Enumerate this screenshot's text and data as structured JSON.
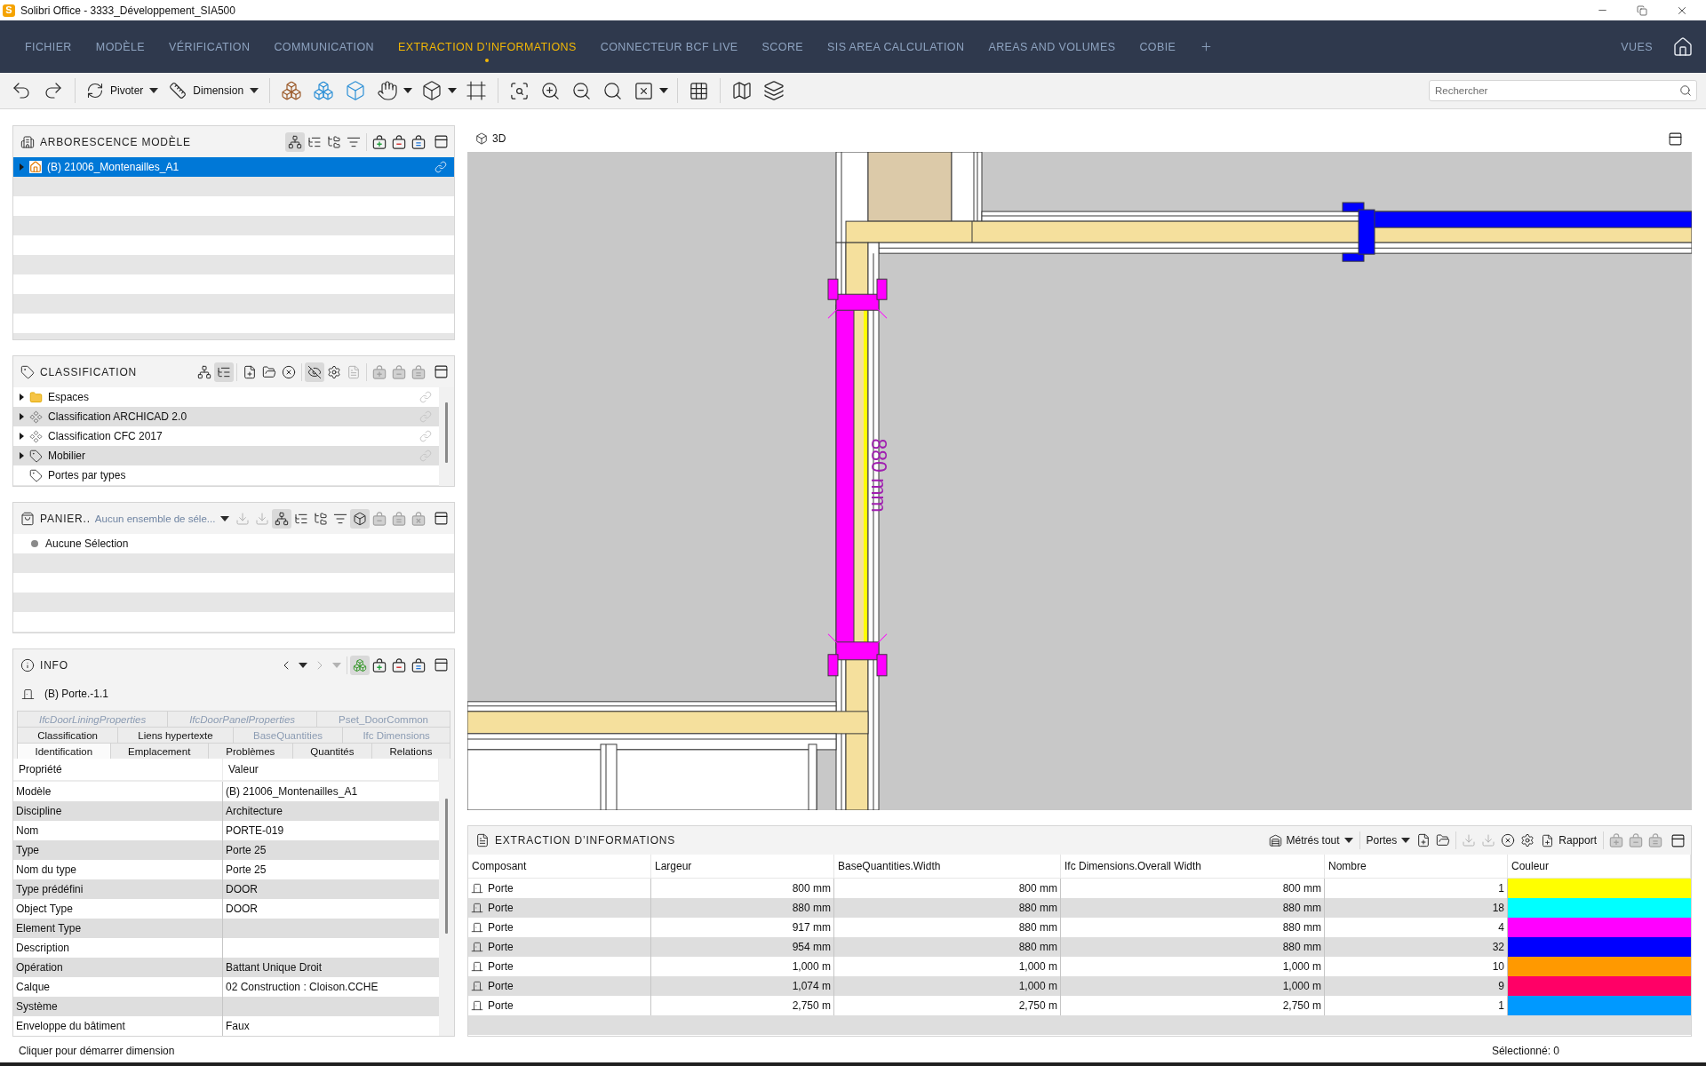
{
  "window": {
    "logo": "S",
    "title": "Solibri Office - 3333_Développement_SIA500"
  },
  "menu": {
    "items": [
      {
        "label": "FICHIER",
        "selected": false
      },
      {
        "label": "MODÈLE",
        "selected": false
      },
      {
        "label": "VÉRIFICATION",
        "selected": false
      },
      {
        "label": "COMMUNICATION",
        "selected": false
      },
      {
        "label": "EXTRACTION D’INFORMATIONS",
        "selected": true
      },
      {
        "label": "CONNECTEUR BCF LIVE",
        "selected": false
      },
      {
        "label": "SCORE",
        "selected": false
      },
      {
        "label": "SIS AREA CALCULATION",
        "selected": false
      },
      {
        "label": "AREAS AND VOLUMES",
        "selected": false
      },
      {
        "label": "COBIE",
        "selected": false
      }
    ],
    "views": "VUES"
  },
  "toolbar": {
    "rotate": "Pivoter",
    "dimension": "Dimension",
    "search": {
      "placeholder": "Rechercher"
    }
  },
  "model_tree": {
    "title": "ARBORESCENCE MODÈLE",
    "tools": [
      {
        "pressed": true,
        "disabled": false
      },
      {
        "pressed": false,
        "disabled": false
      },
      {
        "pressed": false,
        "disabled": false
      },
      {
        "pressed": false,
        "disabled": false
      },
      {
        "pressed": false,
        "disabled": false
      },
      {
        "pressed": false,
        "disabled": false
      },
      {
        "pressed": false,
        "disabled": false
      }
    ],
    "items": [
      {
        "label": "(B) 21006_Montenailles_A1",
        "selected": true,
        "expanded": false,
        "linked": true
      }
    ]
  },
  "classification": {
    "title": "CLASSIFICATION",
    "tools": [
      {
        "pressed": false,
        "disabled": false
      },
      {
        "pressed": true,
        "disabled": false
      },
      {
        "pressed": false,
        "disabled": false
      },
      {
        "pressed": false,
        "disabled": false
      },
      {
        "pressed": false,
        "disabled": false
      },
      {
        "pressed": true,
        "disabled": false
      },
      {
        "pressed": false,
        "disabled": false
      },
      {
        "pressed": false,
        "disabled": true
      },
      {
        "pressed": false,
        "disabled": true
      },
      {
        "pressed": false,
        "disabled": true
      },
      {
        "pressed": false,
        "disabled": true
      }
    ],
    "items": [
      {
        "label": "Espaces",
        "kind": "folder",
        "selected": false,
        "expanded": false,
        "linked": true
      },
      {
        "label": "Classification ARCHICAD 2.0",
        "kind": "classification",
        "selected": false,
        "expanded": false,
        "linked": true
      },
      {
        "label": "Classification CFC 2017",
        "kind": "classification",
        "selected": false,
        "expanded": false,
        "linked": true
      },
      {
        "label": "Mobilier",
        "kind": "tag",
        "selected": false,
        "expanded": false,
        "linked": true
      },
      {
        "label": "Portes par types",
        "kind": "tag",
        "selected": false,
        "linked": false
      }
    ]
  },
  "basket": {
    "title": "PANIER..",
    "selection_set": "Aucun ensemble de séle...",
    "tools": [
      {
        "pressed": false,
        "disabled": true
      },
      {
        "pressed": false,
        "disabled": true
      },
      {
        "pressed": true,
        "disabled": false
      },
      {
        "pressed": false,
        "disabled": false
      },
      {
        "pressed": false,
        "disabled": false
      },
      {
        "pressed": false,
        "disabled": false
      },
      {
        "pressed": true,
        "disabled": false
      },
      {
        "pressed": false,
        "disabled": true
      },
      {
        "pressed": false,
        "disabled": true
      },
      {
        "pressed": false,
        "disabled": true
      }
    ],
    "message": "Aucune Sélection"
  },
  "info": {
    "title": "INFO",
    "tools": [
      {
        "pressed": false,
        "disabled": false
      },
      {
        "pressed": false,
        "disabled": false
      },
      {
        "pressed": false,
        "disabled": true
      },
      {
        "pressed": false,
        "disabled": true
      },
      {
        "pressed": true,
        "disabled": false
      },
      {
        "pressed": false,
        "disabled": false
      },
      {
        "pressed": false,
        "disabled": false
      },
      {
        "pressed": false,
        "disabled": false
      }
    ],
    "object": "(B) Porte.-1.1",
    "tab_rows": [
      [
        {
          "label": "IfcDoorLiningProperties",
          "kind": "type_property_set",
          "selected": false
        },
        {
          "label": "IfcDoorPanelProperties",
          "kind": "type_property_set",
          "selected": false
        },
        {
          "label": "Pset_DoorCommon",
          "kind": "property_set",
          "selected": false
        }
      ],
      [
        {
          "label": "Classification",
          "kind": "standard",
          "selected": false
        },
        {
          "label": "Liens hypertexte",
          "kind": "standard",
          "selected": false
        },
        {
          "label": "BaseQuantities",
          "kind": "property_set",
          "selected": false
        },
        {
          "label": "Ifc Dimensions",
          "kind": "property_set",
          "selected": false
        }
      ],
      [
        {
          "label": "Identification",
          "kind": "standard",
          "selected": true
        },
        {
          "label": "Emplacement",
          "kind": "standard",
          "selected": false
        },
        {
          "label": "Problèmes",
          "kind": "standard",
          "selected": false
        },
        {
          "label": "Quantités",
          "kind": "standard",
          "selected": false
        },
        {
          "label": "Relations",
          "kind": "standard",
          "selected": false
        }
      ]
    ],
    "table": {
      "columns": [
        "Propriété",
        "Valeur"
      ],
      "rows": [
        {
          "property": "Modèle",
          "value": "(B) 21006_Montenailles_A1"
        },
        {
          "property": "Discipline",
          "value": "Architecture"
        },
        {
          "property": "Nom",
          "value": "PORTE-019"
        },
        {
          "property": "Type",
          "value": "Porte 25"
        },
        {
          "property": "Nom du type",
          "value": "Porte 25"
        },
        {
          "property": "Type prédéfini",
          "value": "DOOR"
        },
        {
          "property": "Object Type",
          "value": "DOOR"
        },
        {
          "property": "Element Type"
        },
        {
          "property": "Description"
        },
        {
          "property": "Opération",
          "value": "Battant Unique Droit"
        },
        {
          "property": "Calque",
          "value": "02 Construction : Cloison.CCHE"
        },
        {
          "property": "Système"
        },
        {
          "property": "Enveloppe du bâtiment",
          "value": "Faux"
        }
      ]
    }
  },
  "viewport": {
    "title": "3D",
    "dimension": "880 mm"
  },
  "extraction": {
    "title": "EXTRACTION D’INFORMATIONS",
    "scope": "Métrés tout",
    "filter": "Portes",
    "report": "Rapport",
    "tools": [
      {
        "pressed": false,
        "disabled": false
      },
      {
        "pressed": false,
        "disabled": false
      },
      {
        "pressed": false,
        "disabled": true
      },
      {
        "pressed": false,
        "disabled": true
      },
      {
        "pressed": false,
        "disabled": false
      },
      {
        "pressed": false,
        "disabled": false
      },
      {
        "pressed": false,
        "disabled": true
      },
      {
        "pressed": false,
        "disabled": true
      },
      {
        "pressed": false,
        "disabled": true
      }
    ],
    "table": {
      "columns": [
        "Composant",
        "Largeur",
        "BaseQuantities.Width",
        "Ifc Dimensions.Overall Width",
        "Nombre",
        "Couleur"
      ],
      "rows": [
        {
          "component": "Porte",
          "width": "800 mm",
          "base_width": "800 mm",
          "overall_width": "800 mm",
          "count": "1",
          "color": "#ffff00"
        },
        {
          "component": "Porte",
          "width": "880 mm",
          "base_width": "880 mm",
          "overall_width": "880 mm",
          "count": "18",
          "color": "#00ffff"
        },
        {
          "component": "Porte",
          "width": "917 mm",
          "base_width": "880 mm",
          "overall_width": "880 mm",
          "count": "4",
          "color": "#ff00ff"
        },
        {
          "component": "Porte",
          "width": "954 mm",
          "base_width": "880 mm",
          "overall_width": "880 mm",
          "count": "32",
          "color": "#0000ff"
        },
        {
          "component": "Porte",
          "width": "1,000 m",
          "base_width": "1,000 m",
          "overall_width": "1,000 m",
          "count": "10",
          "color": "#ff9900"
        },
        {
          "component": "Porte",
          "width": "1,074 m",
          "base_width": "1,000 m",
          "overall_width": "1,000 m",
          "count": "9",
          "color": "#ff0066"
        },
        {
          "component": "Porte",
          "width": "2,750 m",
          "base_width": "2,750 m",
          "overall_width": "2,750 m",
          "count": "1",
          "color": "#0099ff"
        }
      ]
    }
  },
  "status_bar": {
    "hint": "Cliquer pour démarrer dimension",
    "selection": "Sélectionné: 0"
  }
}
